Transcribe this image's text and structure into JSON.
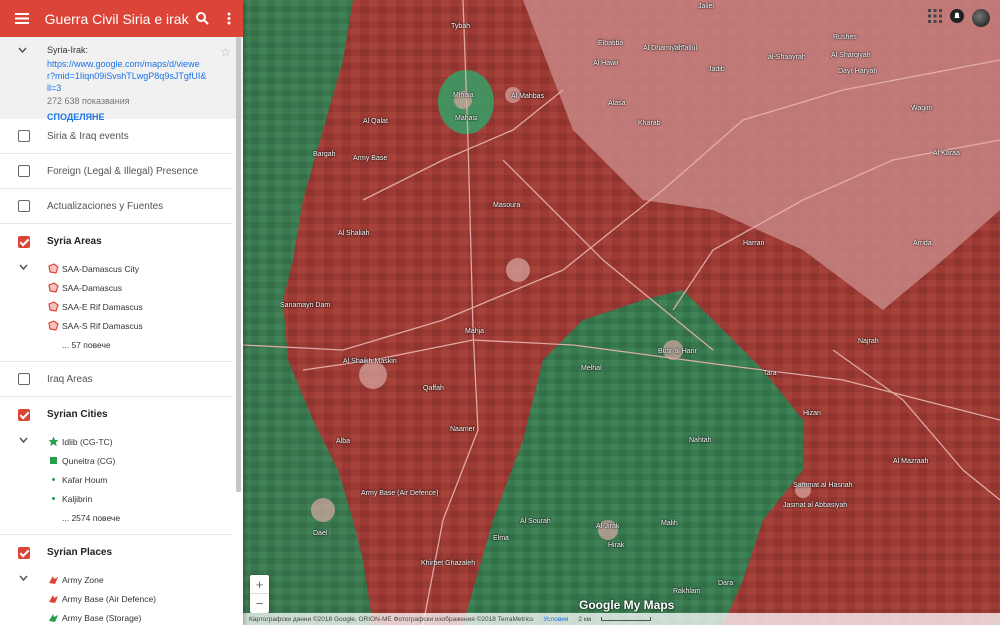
{
  "header": {
    "title": "Guerra Civil Siria e irak"
  },
  "info": {
    "name": "Syria-Irak:",
    "url": "https://www.google.com/maps/d/viewer?mid=1Iiqn09iSvshTLwgP8q9sJTgfUI&ll=3",
    "views": "272 638 показвания",
    "share": "СПОДЕЛЯНЕ"
  },
  "layers": [
    {
      "label": "Siria & Iraq events",
      "checked": false
    },
    {
      "label": "Foreign (Legal & Illegal) Presence",
      "checked": false
    },
    {
      "label": "Actualizaciones y Fuentes",
      "checked": false
    }
  ],
  "syria_areas": {
    "label": "Syria Areas",
    "items": [
      "SAA-Damascus City",
      "SAA-Damascus",
      "SAA-E Rif Damascus",
      "SAA-S Rif Damascus"
    ],
    "more": "... 57 повече"
  },
  "iraq_areas": {
    "label": "Iraq Areas"
  },
  "syrian_cities": {
    "label": "Syrian Cities",
    "items": [
      "Idlib (CG-TC)",
      "Quneitra (CG)",
      "Kafar Houm",
      "Kaljibrin"
    ],
    "more": "... 2574 повече"
  },
  "syrian_places": {
    "label": "Syrian Places",
    "items": [
      "Army Zone",
      "Army Base (Air Defence)",
      "Army Base (Storage)"
    ]
  },
  "colors": {
    "accent": "#db4437",
    "gov_red": "#a83a33",
    "rebel_green": "#2e8b57",
    "city_green": "#2a9d4a"
  },
  "map": {
    "places": [
      "Tybah",
      "Jaliel",
      "Rushes",
      "Al Tallul",
      "Elbatiba",
      "Al Dhamiyah",
      "al-Shaayrah",
      "Jadib",
      "Al Hawir",
      "Dayr Haryah",
      "Kharab",
      "Wagim",
      "Al Mahbas",
      "Alasa",
      "Al Qalat",
      "Mihaja",
      "Mahasi",
      "Bargah",
      "Army Base",
      "Masoura",
      "Al Shaliah",
      "Sanamayn Dam",
      "Al Shaikh Maskin",
      "Qaffah",
      "Alba",
      "Naamer",
      "Mahja",
      "Busr al Harir",
      "Melhal",
      "Nahtah",
      "Tara",
      "Al Mazraah",
      "Sammat al Hasnah",
      "Jasmat al Abbasiyah",
      "Army Base (Air Defence)",
      "Dael",
      "Khirbet Ghazaleh",
      "Elma",
      "Al Sourah",
      "Al-Jirak",
      "Hirak",
      "Malih",
      "Rakhlam",
      "Harran",
      "Hizan",
      "Al Karaa",
      "Najrah",
      "Arrida",
      "Dara",
      "Al Sharqiyah"
    ],
    "logo": "Google My Maps",
    "attribution": "Картографски данни ©2018 Google, ORION-ME Фотографски изображения ©2018 TerraMetrics",
    "terms": "Условия",
    "scale": "2 км"
  }
}
